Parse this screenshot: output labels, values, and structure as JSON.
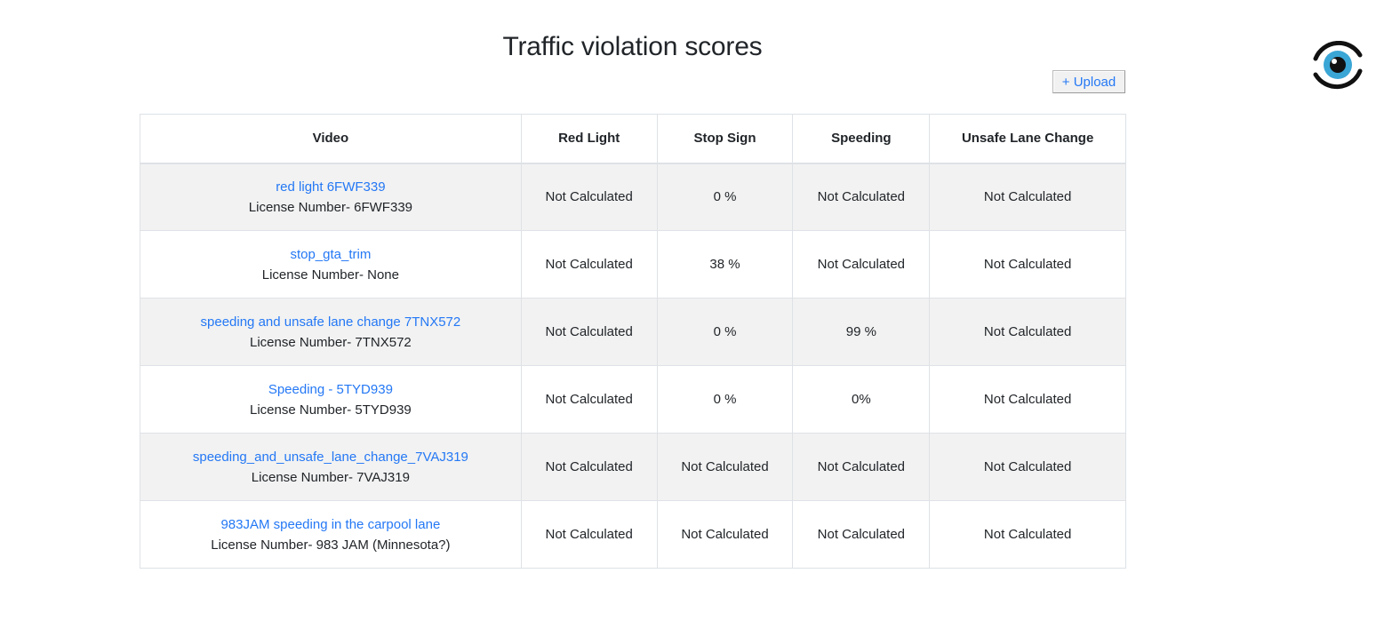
{
  "page": {
    "title": "Traffic violation scores",
    "upload_label": "+ Upload"
  },
  "logo": {
    "icon": "eye-icon",
    "accent": "#3aa6d6"
  },
  "colors": {
    "link": "#2478f5",
    "alert": "#e8101a",
    "stripe": "#f2f2f2"
  },
  "table": {
    "headers": [
      "Video",
      "Red Light",
      "Stop Sign",
      "Speeding",
      "Unsafe Lane Change"
    ],
    "rows": [
      {
        "video": "red light 6FWF339",
        "license": "License Number- 6FWF339",
        "red_light": "Not Calculated",
        "stop_sign": "0 %",
        "speeding": "Not Calculated",
        "lane_change": "Not Calculated"
      },
      {
        "video": "stop_gta_trim",
        "license": "License Number- None",
        "red_light": "Not Calculated",
        "stop_sign": "38 %",
        "speeding": "Not Calculated",
        "lane_change": "Not Calculated"
      },
      {
        "video": "speeding and unsafe lane change 7TNX572",
        "license": "License Number- 7TNX572",
        "red_light": "Not Calculated",
        "stop_sign": "0 %",
        "speeding": "99 %",
        "lane_change": "Not Calculated"
      },
      {
        "video": "Speeding - 5TYD939",
        "license": "License Number- 5TYD939",
        "red_light": "Not Calculated",
        "stop_sign": "0 %",
        "speeding": "0%",
        "lane_change": "Not Calculated"
      },
      {
        "video": "speeding_and_unsafe_lane_change_7VAJ319",
        "license": "License Number- 7VAJ319",
        "red_light": "Not Calculated",
        "stop_sign": "Not Calculated",
        "speeding": "Not Calculated",
        "lane_change": "Not Calculated"
      },
      {
        "video": "983JAM speeding in the carpool lane",
        "license": "License Number- 983 JAM (Minnesota?)",
        "red_light": "Not Calculated",
        "stop_sign": "Not Calculated",
        "speeding": "Not Calculated",
        "lane_change": "Not Calculated"
      }
    ]
  }
}
